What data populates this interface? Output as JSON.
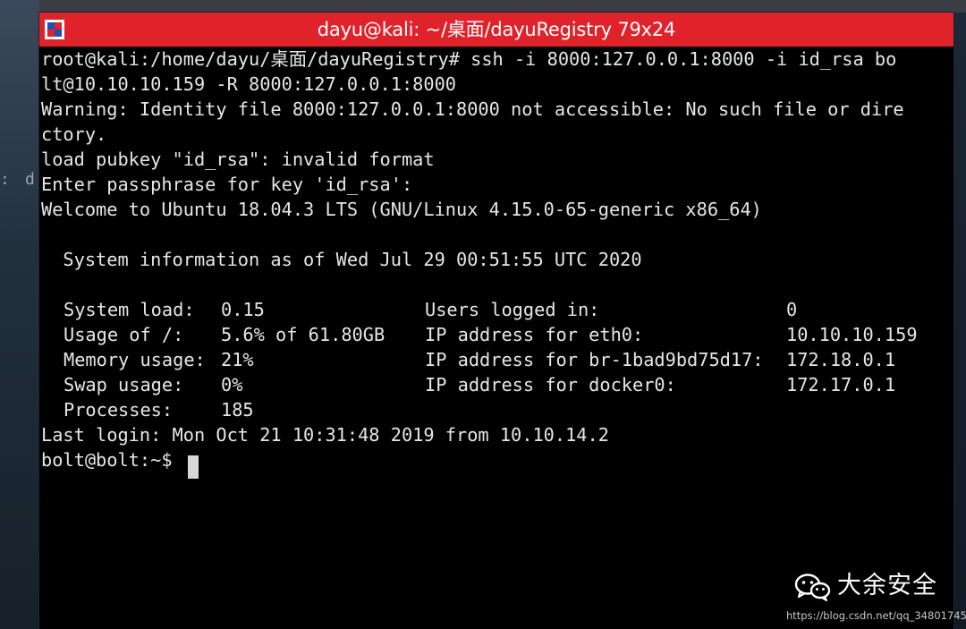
{
  "window": {
    "title": "dayu@kali: ~/桌面/dayuRegistry 79x24",
    "app_icon": "terminal-app-icon"
  },
  "desktop": {
    "side_text_a": ":",
    "side_text_b": "d"
  },
  "terminal": {
    "lines": [
      "root@kali:/home/dayu/桌面/dayuRegistry# ssh -i 8000:127.0.0.1:8000 -i id_rsa bo",
      "lt@10.10.10.159 -R 8000:127.0.0.1:8000",
      "Warning: Identity file 8000:127.0.0.1:8000 not accessible: No such file or dire",
      "ctory.",
      "load pubkey \"id_rsa\": invalid format",
      "Enter passphrase for key 'id_rsa':",
      "Welcome to Ubuntu 18.04.3 LTS (GNU/Linux 4.15.0-65-generic x86_64)",
      "",
      "  System information as of Wed Jul 29 00:51:55 UTC 2020",
      ""
    ],
    "sysinfo_left": [
      {
        "label": "System load:",
        "value": "0.15"
      },
      {
        "label": "Usage of /:",
        "value": "5.6% of 61.80GB"
      },
      {
        "label": "Memory usage:",
        "value": "21%"
      },
      {
        "label": "Swap usage:",
        "value": "0%"
      },
      {
        "label": "Processes:",
        "value": "185"
      }
    ],
    "sysinfo_right": [
      {
        "label": "Users logged in:",
        "value": "0"
      },
      {
        "label": "IP address for eth0:",
        "value": "10.10.10.159"
      },
      {
        "label": "IP address for br-1bad9bd75d17:",
        "value": "172.18.0.1"
      },
      {
        "label": "IP address for docker0:",
        "value": "172.17.0.1"
      }
    ],
    "last_login": "Last login: Mon Oct 21 10:31:48 2019 from 10.10.14.2",
    "prompt": "bolt@bolt:~$"
  },
  "watermark": {
    "name": "大余安全",
    "url": "https://blog.csdn.net/qq_34801745",
    "icon": "wechat-icon"
  },
  "colors": {
    "titlebar": "#e0222b",
    "terminal_bg": "#000000",
    "terminal_fg": "#e6e6e6"
  }
}
